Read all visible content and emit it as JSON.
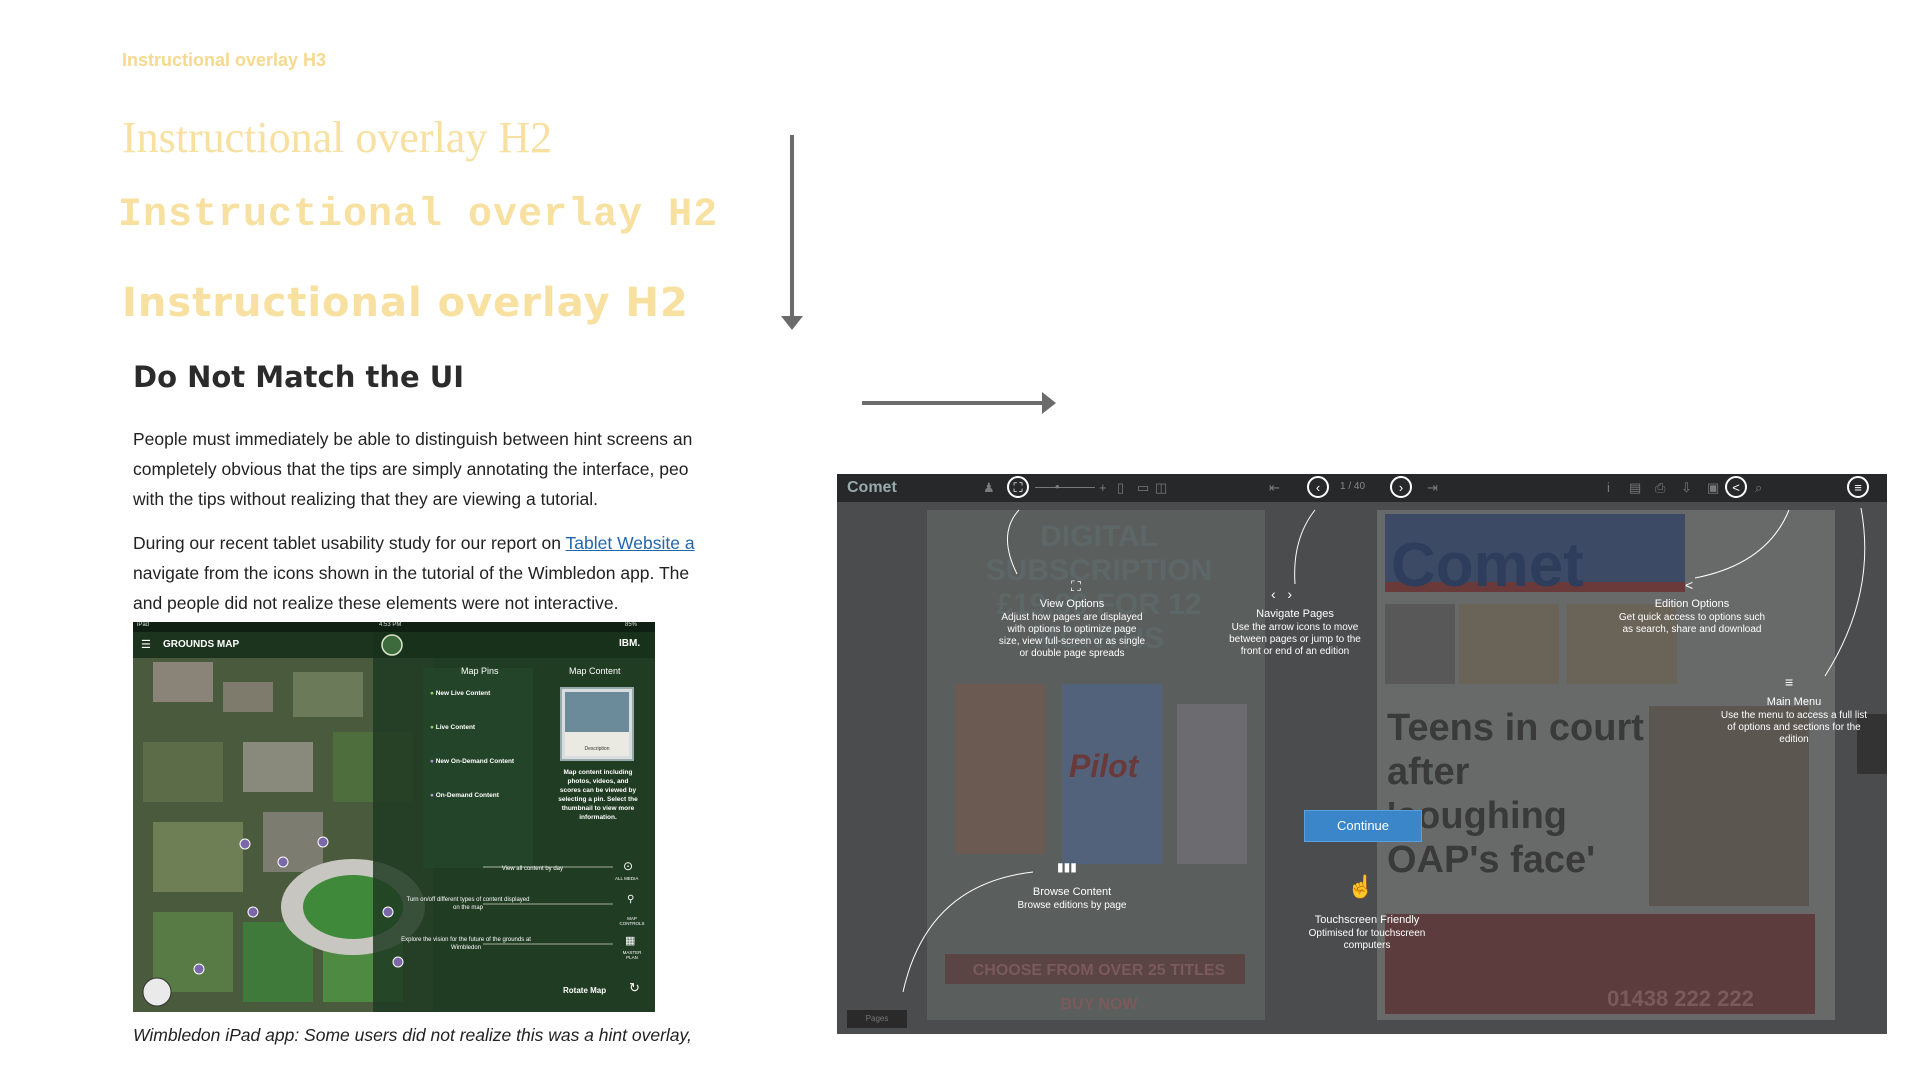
{
  "samples": {
    "h3": "Instructional overlay H3",
    "h2_serif": "Instructional overlay H2",
    "h2_mono": "Instructional overlay H2",
    "h2_rounded": "Instructional overlay H2"
  },
  "article": {
    "heading": "Do Not Match the UI",
    "p1_l1": "People must immediately be able to distinguish between hint screens an",
    "p1_l2": "completely obvious that the tips are simply annotating the interface, peo",
    "p1_l3": "with the tips without realizing that they are viewing a tutorial.",
    "p2_l1_pre": "During our recent tablet usability study for our report on ",
    "p2_l1_link": "Tablet Website a",
    "p2_l2": "navigate from the icons shown in the tutorial of the Wimbledon app. The",
    "p2_l3": "and people did not realize these elements were not interactive.",
    "caption": "Wimbledon iPad app: Some users did not realize this was a hint overlay,"
  },
  "wimbledon": {
    "status_left": "iPad",
    "status_time": "4:53 PM",
    "status_right": "85%",
    "title": "GROUNDS MAP",
    "brand": "IBM.",
    "tab_pins": "Map Pins",
    "tab_content": "Map Content",
    "pins": [
      "New Live Content",
      "Live Content",
      "New On-Demand Content",
      "On-Demand Content"
    ],
    "thumb_label": "Description",
    "content_desc": "Map content including photos, videos, and scores can be viewed by selecting a pin. Select the thumbnail to view more information.",
    "hint_day": "View all content by day",
    "hint_day_label": "ALL MEDIA",
    "hint_toggle": "Turn on/off different types of content displayed on the map",
    "hint_toggle_label": "MAP CONTROLS",
    "hint_future": "Explore the vision for the future of the grounds at Wimbledon",
    "hint_future_label": "MASTER PLAN",
    "rotate": "Rotate Map"
  },
  "comet": {
    "logo": "Comet",
    "page_counter": "1 / 40",
    "view_options_title": "View Options",
    "view_options_desc": "Adjust how pages are displayed with options to optimize page size, view full-screen or as single or double page spreads",
    "navigate_title": "Navigate Pages",
    "navigate_desc": "Use the arrow icons to move between pages or jump to the front or end of an edition",
    "edition_title": "Edition Options",
    "edition_desc": "Get quick access to options such as search, share and download",
    "menu_title": "Main Menu",
    "menu_desc": "Use the menu to access a full list of options and sections for the edition",
    "browse_title": "Browse Content",
    "browse_desc": "Browse editions by page",
    "touch_title": "Touchscreen Friendly",
    "touch_desc": "Optimised for touchscreen computers",
    "continue": "Continue",
    "bg_headline": "Teens in court after 'coughing OAP's face'",
    "bg_sub": "DIGITAL SUBSCRIPTION £19.99 FOR 12 MONTHS",
    "bg_choose": "CHOOSE FROM OVER 25 TITLES",
    "bg_buy": "BUY NOW",
    "bg_phone": "01438 222 222",
    "bg_pilot": "Pilot",
    "bg_tab": "Pages"
  },
  "colors": {
    "sample_yellow": "#f7e0a0",
    "link": "#2266aa",
    "continue": "#3a86c8",
    "arrow": "#6b6b6b"
  }
}
